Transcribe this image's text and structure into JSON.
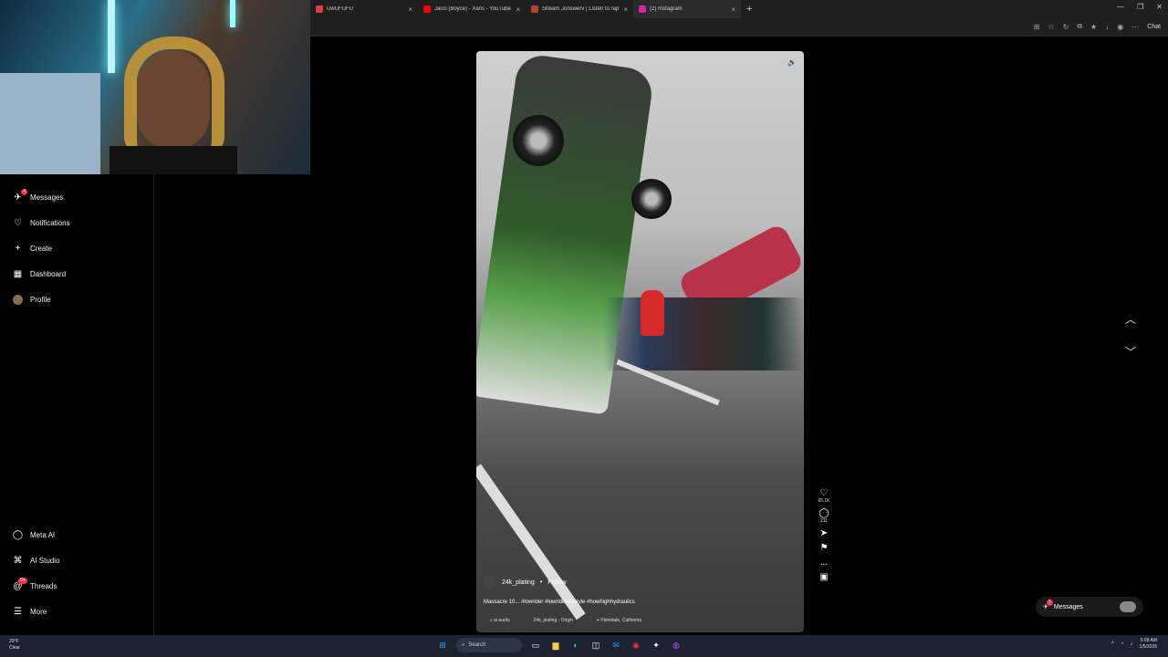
{
  "browser": {
    "tabs": [
      {
        "label": "UwUFUFU",
        "color": "#e23a3a"
      },
      {
        "label": "Jacci (Boyce) - Xans - YouTube",
        "color": "#ff0000"
      },
      {
        "label": "Stream Jonswerv | Listen to rap pl",
        "color": "#b5452b"
      },
      {
        "label": "(2) Instagram",
        "color": "#d6249f"
      }
    ],
    "new_tab": "+",
    "chat_label": "Chat"
  },
  "sidebar": {
    "items": [
      {
        "label": "Messages",
        "badge": "4"
      },
      {
        "label": "Notifications"
      },
      {
        "label": "Create"
      },
      {
        "label": "Dashboard"
      },
      {
        "label": "Profile"
      }
    ],
    "bottom_items": [
      {
        "label": "Meta AI"
      },
      {
        "label": "AI Studio"
      },
      {
        "label": "Threads",
        "badge": "9+"
      },
      {
        "label": "More"
      }
    ]
  },
  "reel": {
    "username": "24k_plating",
    "follow": "Follow",
    "caption": "Massacre 10... #lowrider #lowriderlifestyle #howhighhydraulics",
    "audio": "ai audio",
    "audio_original": "24k_plating · Origin",
    "location": "Palmdale, California",
    "likes": "65.1K",
    "comments": "211",
    "more": "..."
  },
  "messages_pill": {
    "label": "Messages",
    "badge": "1"
  },
  "taskbar": {
    "weather_temp": "29°F",
    "weather_desc": "Clear",
    "search": "Search",
    "time": "5:08 AM",
    "date": "1/5/2026"
  },
  "colors": {
    "accent": "#ff3040",
    "bg": "#000000"
  }
}
